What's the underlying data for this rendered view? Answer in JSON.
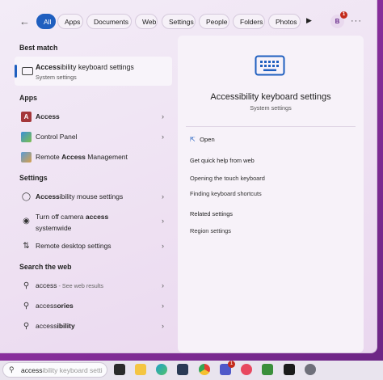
{
  "filters": {
    "tabs": [
      "All",
      "Apps",
      "Documents",
      "Web",
      "Settings",
      "People",
      "Folders",
      "Photos"
    ],
    "active": "All",
    "avatar_letter": "B",
    "avatar_badge": "1",
    "more_label": "···"
  },
  "best_match": {
    "header": "Best match",
    "title_bold": "Access",
    "title_rest": "ibility keyboard settings",
    "subtitle": "System settings"
  },
  "apps": {
    "header": "Apps",
    "items": [
      {
        "bold": "Access",
        "rest": "",
        "icon": "access-icon"
      },
      {
        "bold": "",
        "rest": "Control Panel",
        "icon": "control-panel-icon"
      },
      {
        "pre": "Remote ",
        "bold": "Access",
        "rest": " Management",
        "icon": "remote-access-icon"
      }
    ]
  },
  "settings": {
    "header": "Settings",
    "items": [
      {
        "bold": "Access",
        "rest": "ibility mouse settings",
        "icon": "mouse-icon"
      },
      {
        "pre": "Turn off camera ",
        "bold": "access",
        "rest": "",
        "line2": "systemwide",
        "icon": "camera-icon"
      },
      {
        "pre": "",
        "bold": "",
        "rest": "Remote desktop settings",
        "icon": "remote-desktop-icon"
      }
    ]
  },
  "web": {
    "header": "Search the web",
    "items": [
      {
        "term": "access",
        "suffix": " - See web results"
      },
      {
        "term": "access",
        "bold": "ories"
      },
      {
        "term": "access",
        "bold": "ibility"
      }
    ]
  },
  "detail": {
    "title": "Accessibility keyboard settings",
    "subtitle": "System settings",
    "open": "Open",
    "quick_help": "Get quick help from web",
    "help_links": [
      "Opening the touch keyboard",
      "Finding keyboard shortcuts"
    ],
    "related_header": "Related settings",
    "related": [
      "Region settings"
    ]
  },
  "taskbar": {
    "search_typed": "access",
    "search_ghost": "ibility keyboard setti",
    "teams_badge": "1"
  },
  "colors": {
    "accent": "#1f5fbf"
  }
}
